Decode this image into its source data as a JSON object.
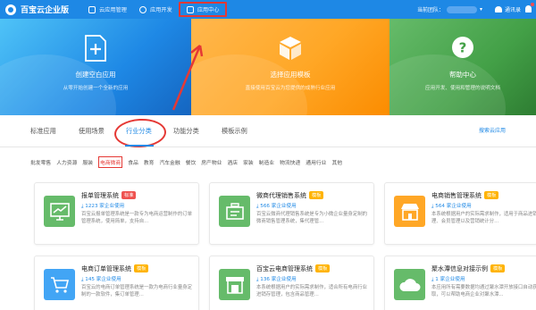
{
  "header": {
    "logo_text": "百宝云企业版",
    "nav": [
      {
        "label": "云应用管理"
      },
      {
        "label": "应用开发"
      },
      {
        "label": "应用中心"
      }
    ],
    "team_label": "当前团队：",
    "contacts_label": "通讯录"
  },
  "banner": [
    {
      "title": "创建空白应用",
      "desc": "从零开始创建一个全新的应用",
      "color": "#1e88e5",
      "icon": "add-file-icon"
    },
    {
      "title": "选择应用模板",
      "desc": "直接使用百宝云为您提供的成熟行业应用",
      "color": "#ffa726",
      "icon": "cube-icon"
    },
    {
      "title": "帮助中心",
      "desc": "应用开发、使用和管理的说明文档",
      "color": "#43a047",
      "icon": "help-icon"
    }
  ],
  "tabs": [
    {
      "label": "标准应用"
    },
    {
      "label": "使用场景"
    },
    {
      "label": "行业分类"
    },
    {
      "label": "功能分类"
    },
    {
      "label": "模板示例"
    }
  ],
  "search_link": "搜索云应用",
  "categories": [
    "批发零售",
    "人力资源",
    "服装",
    "电商微商",
    "食品",
    "教育",
    "汽车金融",
    "餐饮",
    "房产物业",
    "酒店",
    "家装",
    "制造业",
    "物流快递",
    "通用行业",
    "其他"
  ],
  "cards": [
    {
      "title": "报单管理系统",
      "badge": "标准",
      "badge_color": "#ef5350",
      "count": "1223 家企业使用",
      "desc": "百宝云报单管理系统是一款专为电商运营制作的订单管理系统，使用简单，支持自...",
      "icon_color": "#66bb6a",
      "icon": "chart-board-icon"
    },
    {
      "title": "微商代理销售系统",
      "badge": "模板",
      "badge_color": "#ffb300",
      "count": "566 家企业使用",
      "desc": "百宝云微商代理销售系统是专为小微企业量身定制的微商销售管理系统，集代理管...",
      "icon_color": "#66bb6a",
      "icon": "register-icon"
    },
    {
      "title": "电商销售管理系统",
      "badge": "模板",
      "badge_color": "#ffb300",
      "count": "564 家企业使用",
      "desc": "本系统根据用户的实际需求制作，适用于商品进销管理、会员管理以及营销统计分...",
      "icon_color": "#ffa726",
      "icon": "store-icon"
    },
    {
      "title": "电商订单管理系统",
      "badge": "模板",
      "badge_color": "#ffb300",
      "count": "145 家企业使用",
      "desc": "百宝云的电商订单管理系统是一款为电商行业量身定制的一款软件，集订单管理...",
      "icon_color": "#42a5f5",
      "icon": "cart-icon"
    },
    {
      "title": "百宝云电商管理系统",
      "badge": "模板",
      "badge_color": "#ffb300",
      "count": "136 家企业使用",
      "desc": "本系统根据用户的实际需求制作，适合所有电商行业进销存管理，包含商品管理...",
      "icon_color": "#66bb6a",
      "icon": "shop-icon"
    },
    {
      "title": "聚水潭信息对接示例",
      "badge": "模板",
      "badge_color": "#ffb300",
      "count": "1 家企业使用",
      "desc": "本应用所有需要数据均通过聚水潭开放接口自动获取，可以帮助电商企业对聚水潭...",
      "icon_color": "#66bb6a",
      "icon": "cloud-icon"
    }
  ]
}
